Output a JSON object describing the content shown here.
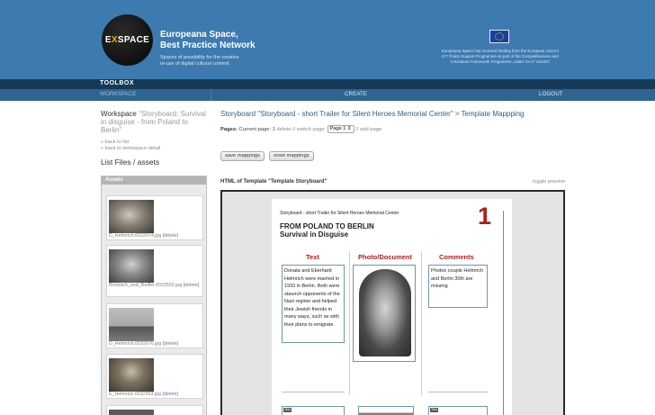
{
  "header": {
    "logo_left": "E",
    "logo_x": "X",
    "logo_right": "SPACE",
    "brand_line1": "Europeana Space,",
    "brand_line2": "Best Practice Network",
    "tagline1": "Spaces of possibility for the creative",
    "tagline2": "re-use of digital cultural content",
    "eu_line1": "Europeana Space has received funding from the European Union's",
    "eu_line2": "ICT Policy Support Programme as part of the Competitiveness and",
    "eu_line3": "Innovation Framework Programme, under GA n° 621037"
  },
  "nav": {
    "toolbox": "TOOLBOX",
    "workspace": "WORKSPACE",
    "create": "CREATE",
    "logout": "LOGOUT"
  },
  "sidebar": {
    "ws_label": "Workspace",
    "ws_name": "\"Storyboard: Survival in disguise - from Poland to Berlin\"",
    "back_to_list": "« back to list",
    "back_to_detail": "« back to workspace-detail",
    "list_files": "List Files / assets",
    "assets_header": "Assets",
    "assets": [
      {
        "file": "D_Helmrich.0032974.jpg",
        "delete": "[delete]"
      },
      {
        "file": "Birnbach_und_Reifler.0033592.jpg",
        "delete": "[delete]"
      },
      {
        "file": "D_Helmrich.0032976.jpg",
        "delete": "[delete]"
      },
      {
        "file": "E_Helmrich.0032963.jpg",
        "delete": "[delete]"
      }
    ]
  },
  "main": {
    "breadcrumb": "Storyboard \"Storyboard - short Trailer for Silent Heroes Memorial Center\" > Template Mappping",
    "pages_label": "Pages:",
    "current_page_text": "Current page: 1",
    "delete_link": "delete",
    "switch_page": "// switch page:",
    "page_select_value": "Page 1",
    "add_page": "// add page",
    "save_mappings": "save mappings",
    "reset_mappings": "reset mappings",
    "html_template_label": "HTML of Template \"Template Storyboard\"",
    "toggle_preview": "toggle preview"
  },
  "preview": {
    "small_title": "Storyboard - short Trailer for Silent Heroes Memorial Center",
    "title_line1": "FROM POLAND TO BERLIN",
    "title_line2": "Survival in Disguise",
    "page_number": "1",
    "col_text": "Text",
    "col_photo": "Photo/Document",
    "col_comments": "Comments",
    "text_body": "Donata and Eberhard Helmrich were married in 1933 in Berlin. Both were staunch opponents of the Nazi regime and helped their Jewish friends in many ways, such as with their plans to emigrate.",
    "comments_body": "Photos couple Helmrich and Berlin 30th are missing",
    "mini_label": "Text"
  }
}
